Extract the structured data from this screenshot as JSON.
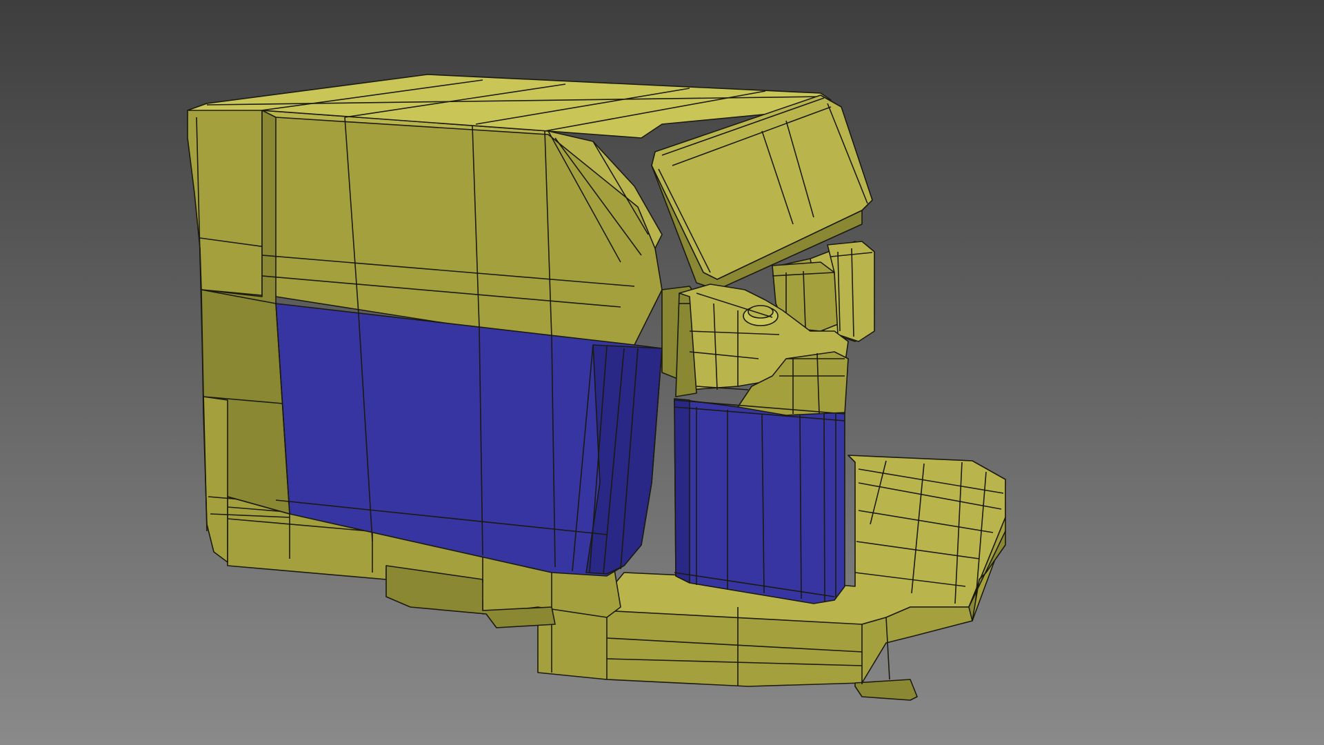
{
  "viewport": {
    "background_top": "#3e3e3e",
    "background_bottom": "#8a8a8a",
    "wire_color": "#1a1a10"
  },
  "model": {
    "subject": "coffee-machine-wireframe",
    "colors": {
      "yellow_top": "#c9c556",
      "yellow_light": "#b9b54c",
      "yellow_mid": "#a4a03d",
      "yellow_side": "#8a8832",
      "yellow_dark": "#6f6d27",
      "blue_main": "#3735a2",
      "blue_light": "#3f3db4",
      "blue_dark": "#2a2886"
    }
  }
}
